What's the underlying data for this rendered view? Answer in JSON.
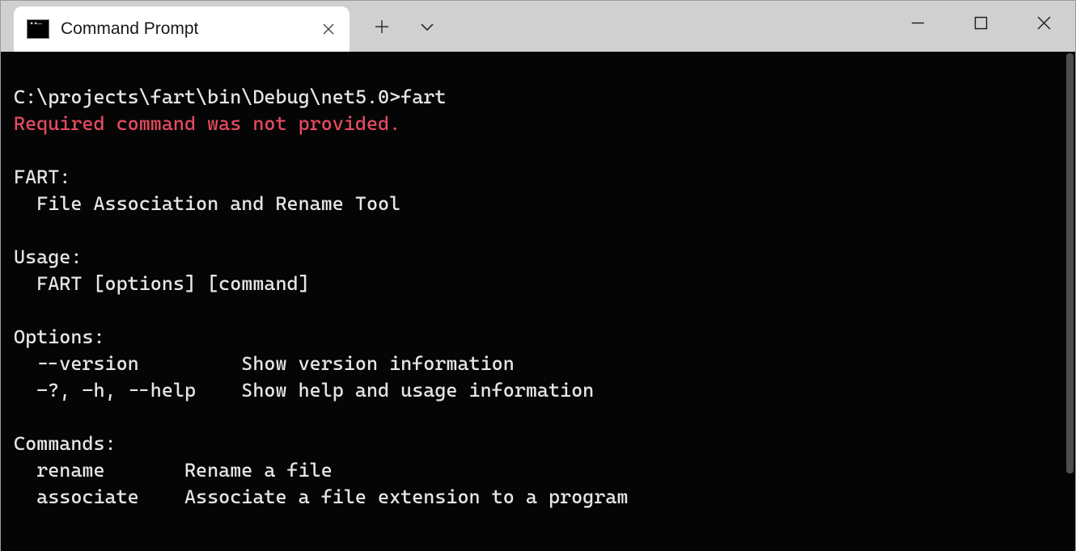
{
  "window": {
    "tab": {
      "title": "Command Prompt"
    },
    "controls": {
      "minimize": "minimize",
      "maximize": "maximize",
      "close": "close"
    }
  },
  "terminal": {
    "prompt": "C:\\projects\\fart\\bin\\Debug\\net5.0>",
    "command": "fart",
    "error": "Required command was not provided.",
    "help": {
      "header": "FART:",
      "description": "  File Association and Rename Tool",
      "usage_header": "Usage:",
      "usage_line": "  FART [options] [command]",
      "options_header": "Options:",
      "options": [
        "  --version         Show version information",
        "  -?, -h, --help    Show help and usage information"
      ],
      "commands_header": "Commands:",
      "commands": [
        "  rename       Rename a file",
        "  associate    Associate a file extension to a program"
      ]
    }
  }
}
